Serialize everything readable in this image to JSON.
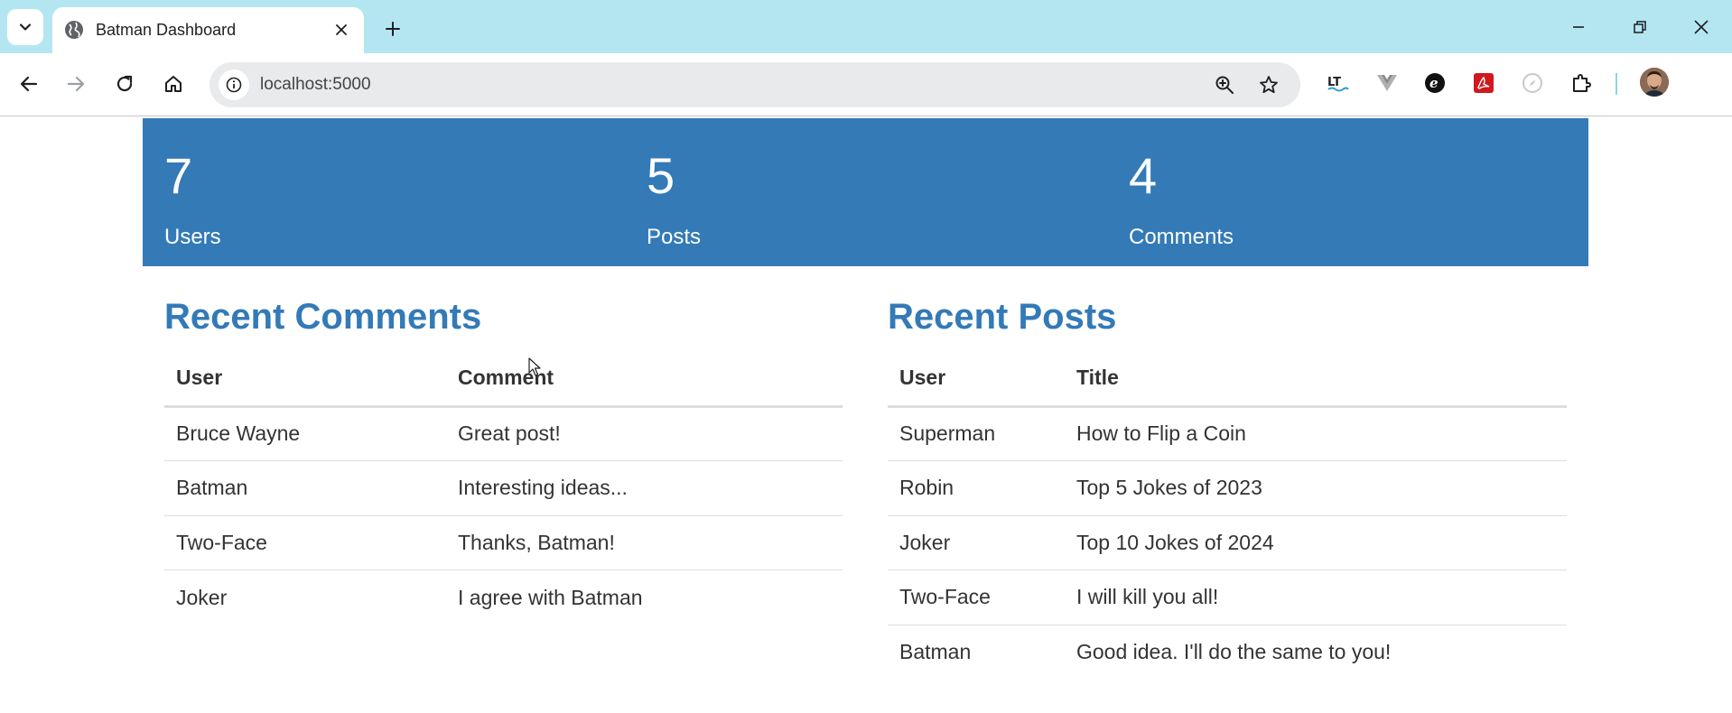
{
  "browser": {
    "tab": {
      "title": "Batman Dashboard"
    },
    "address_bar": {
      "url": "localhost:5000"
    },
    "extensions": [
      "languagetool-icon",
      "vue-devtools-icon",
      "e-extension-icon",
      "pdf-icon",
      "compass-icon",
      "puzzle-extensions-icon"
    ]
  },
  "stats": [
    {
      "value": "7",
      "label": "Users"
    },
    {
      "value": "5",
      "label": "Posts"
    },
    {
      "value": "4",
      "label": "Comments"
    }
  ],
  "recent_comments": {
    "title": "Recent Comments",
    "columns": [
      "User",
      "Comment"
    ],
    "rows": [
      [
        "Bruce Wayne",
        "Great post!"
      ],
      [
        "Batman",
        "Interesting ideas..."
      ],
      [
        "Two-Face",
        "Thanks, Batman!"
      ],
      [
        "Joker",
        "I agree with Batman"
      ]
    ]
  },
  "recent_posts": {
    "title": "Recent Posts",
    "columns": [
      "User",
      "Title"
    ],
    "rows": [
      [
        "Superman",
        "How to Flip a Coin"
      ],
      [
        "Robin",
        "Top 5 Jokes of 2023"
      ],
      [
        "Joker",
        "Top 10 Jokes of 2024"
      ],
      [
        "Two-Face",
        "I will kill you all!"
      ],
      [
        "Batman",
        "Good idea. I'll do the same to you!"
      ]
    ]
  },
  "colors": {
    "primary": "#337ab7",
    "tabstrip": "#b4e6f2"
  }
}
